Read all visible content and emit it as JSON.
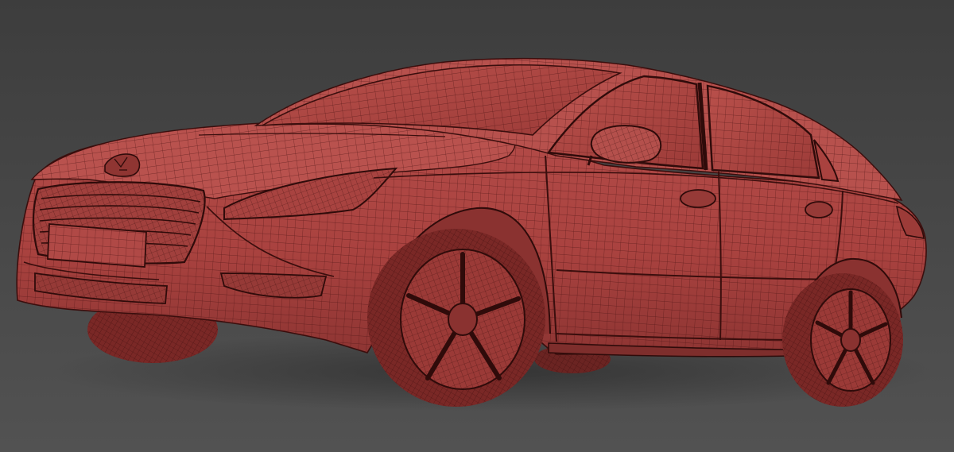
{
  "scene": {
    "background_top": "#3d3d3d",
    "background_bottom": "#525252",
    "body_color": "#b34b48",
    "body_shade": "#8e3533",
    "body_highlight": "#c86a63",
    "wire_color": "#4a1312",
    "tire_color": "#7a2826",
    "shadow_color": "#2d2d2d"
  },
  "model": {
    "type": "sedan",
    "render_mode": "wireframe-on-shaded",
    "badge_icon": "lion-emblem-icon",
    "wheel_spoke_count": 5
  }
}
